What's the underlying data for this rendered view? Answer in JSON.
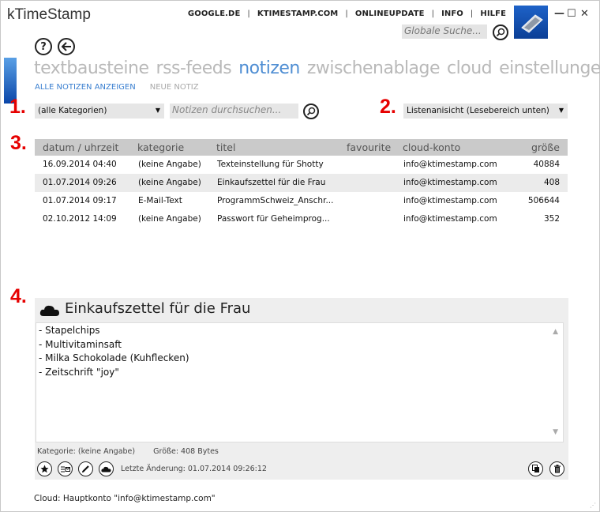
{
  "app": {
    "title": "kTimeStamp"
  },
  "topnav": [
    "GOOGLE.DE",
    "KTIMESTAMP.COM",
    "ONLINEUPDATE",
    "INFO",
    "HILFE"
  ],
  "global_search": {
    "placeholder": "Globale Suche..."
  },
  "window_controls": {
    "minimize": "—",
    "maximize": "☐",
    "close": "✕"
  },
  "nav": {
    "help": "?"
  },
  "main_tabs": [
    "textbausteine",
    "rss-feeds",
    "notizen",
    "zwischenablage",
    "cloud",
    "einstellungen"
  ],
  "active_tab": "notizen",
  "sub_tabs": {
    "show_all": "ALLE NOTIZEN ANZEIGEN",
    "new_note": "NEUE NOTIZ"
  },
  "markers": {
    "one": "1.",
    "two": "2.",
    "three": "3.",
    "four": "4."
  },
  "filters": {
    "category": "(alle Kategorien)",
    "notes_search_placeholder": "Notizen durchsuchen...",
    "view_mode": "Listenanisicht (Lesebereich unten)"
  },
  "table": {
    "headers": [
      "datum / uhrzeit",
      "kategorie",
      "titel",
      "favourite",
      "cloud-konto",
      "größe"
    ],
    "rows": [
      {
        "date": "16.09.2014 04:40",
        "category": "(keine Angabe)",
        "title": "Texteinstellung für Shotty",
        "cloud": "info@ktimestamp.com",
        "size": "40884"
      },
      {
        "date": "01.07.2014 09:26",
        "category": "(keine Angabe)",
        "title": "Einkaufszettel für die Frau",
        "cloud": "info@ktimestamp.com",
        "size": "408"
      },
      {
        "date": "01.07.2014 09:17",
        "category": "E-Mail-Text",
        "title": "ProgrammSchweiz_Anschr...",
        "cloud": "info@ktimestamp.com",
        "size": "506644"
      },
      {
        "date": "02.10.2012 14:09",
        "category": "(keine Angabe)",
        "title": "Passwort für Geheimprog...",
        "cloud": "info@ktimestamp.com",
        "size": "352"
      }
    ],
    "selected_row": 1
  },
  "preview": {
    "title": "Einkaufszettel für die Frau",
    "lines": [
      "- Stapelchips",
      "- Multivitaminsaft",
      "- Milka Schokolade (Kuhflecken)",
      "- Zeitschrift \"joy\""
    ],
    "category_meta": "Kategorie: (keine Angabe)",
    "size_meta": "Größe: 408 Bytes",
    "last_change": "Letzte Änderung: 01.07.2014 09:26:12"
  },
  "status": {
    "cloud": "Cloud: Hauptkonto \"info@ktimestamp.com\""
  },
  "colors": {
    "accent": "#4f8ed3",
    "marker": "#e60000",
    "header_bg": "#cacaca"
  }
}
